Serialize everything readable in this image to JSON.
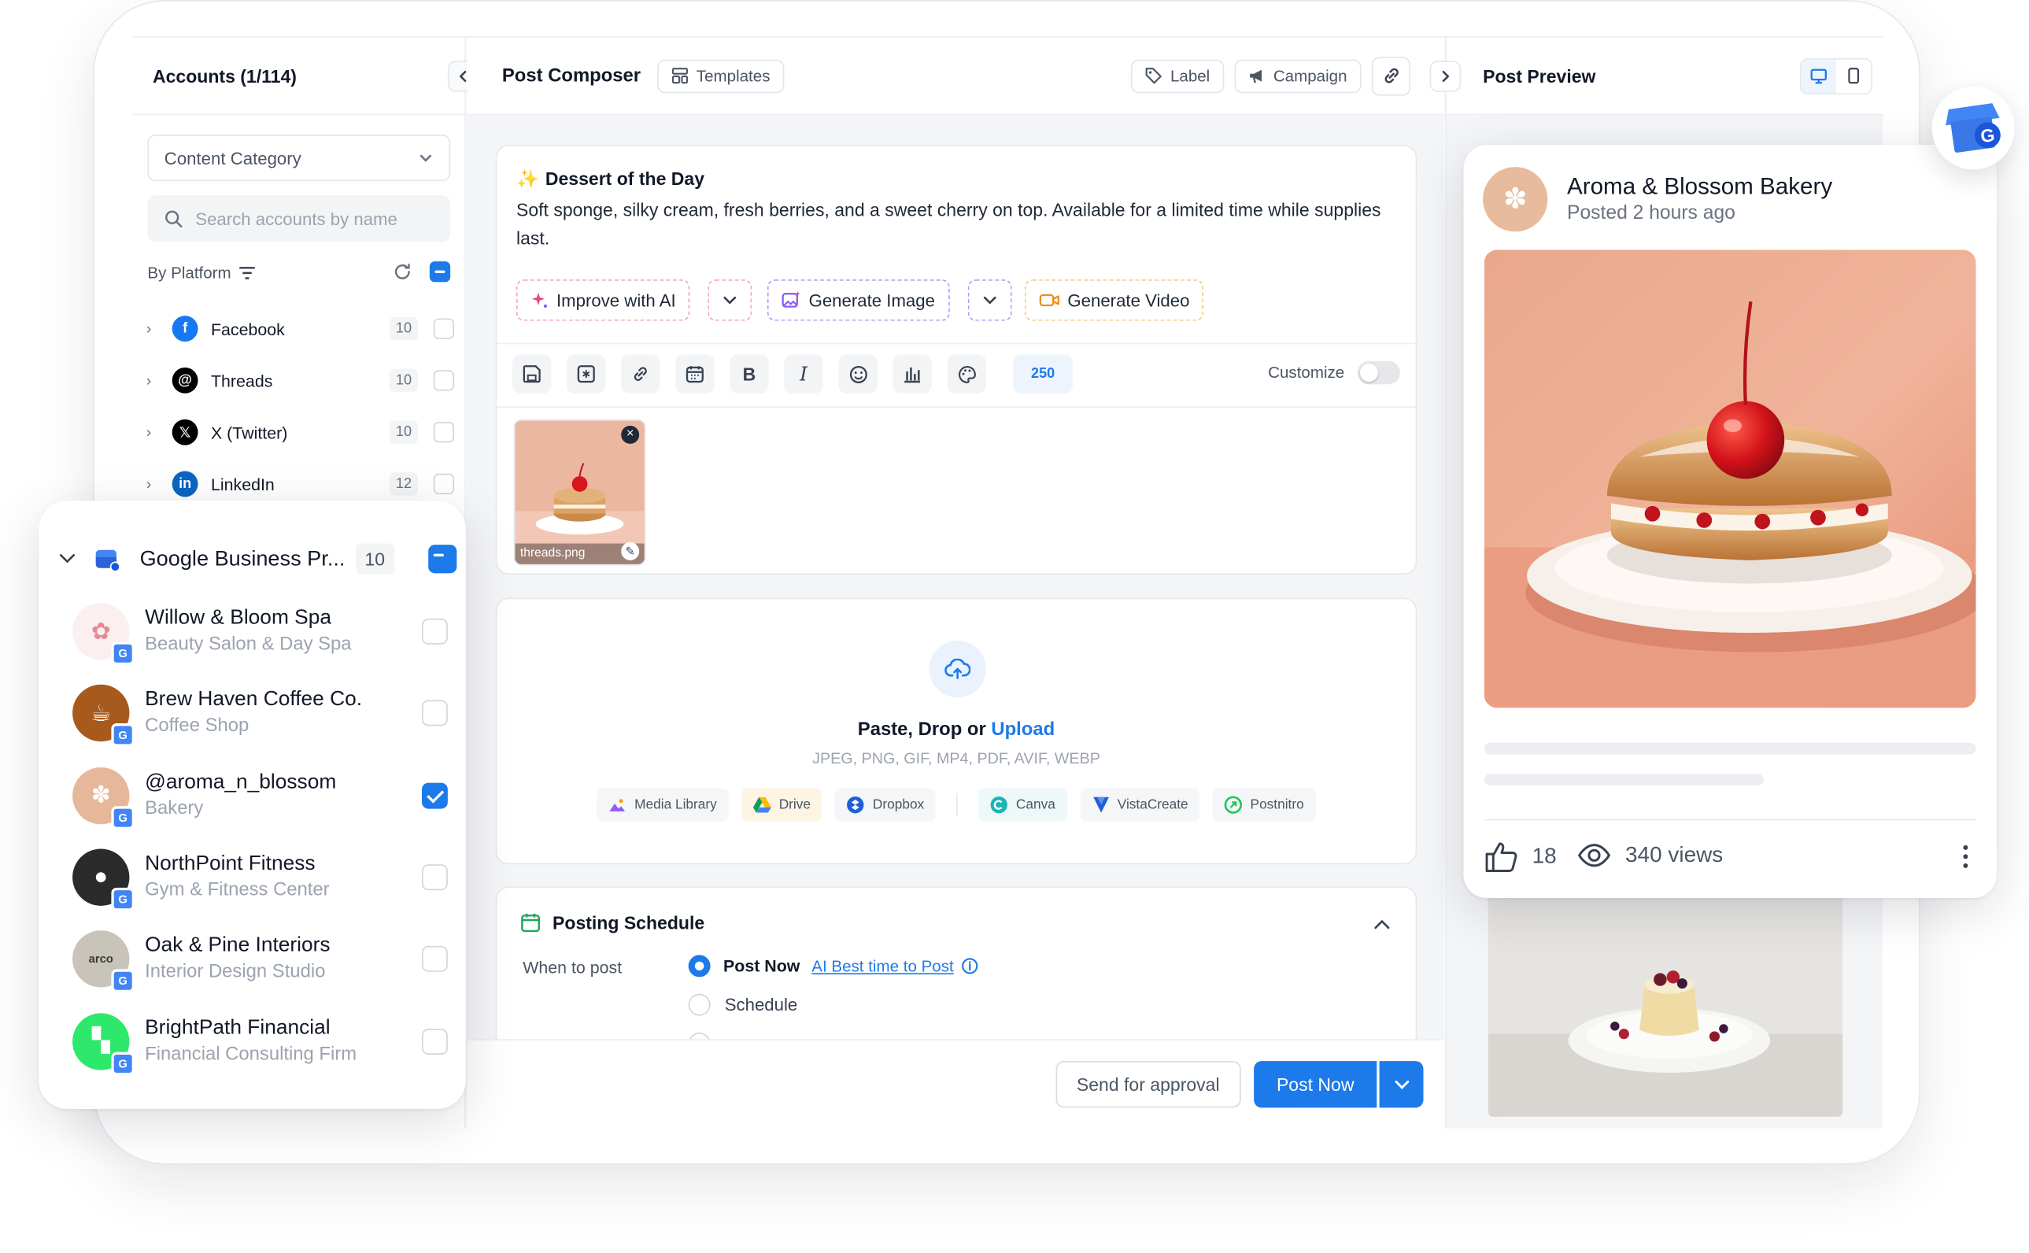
{
  "accounts_panel": {
    "title": "Accounts (1/114)",
    "category_select": "Content Category",
    "search_placeholder": "Search accounts by name",
    "filter_label": "By Platform",
    "platforms": [
      {
        "name": "Facebook",
        "count": "10",
        "color": "#1877f2",
        "glyph": "f"
      },
      {
        "name": "Threads",
        "count": "10",
        "color": "#000000",
        "glyph": "@"
      },
      {
        "name": "X (Twitter)",
        "count": "10",
        "color": "#000000",
        "glyph": "𝕏"
      },
      {
        "name": "LinkedIn",
        "count": "12",
        "color": "#0a66c2",
        "glyph": "in"
      }
    ]
  },
  "gbp_group": {
    "name": "Google Business Pr...",
    "count": "10",
    "accounts": [
      {
        "name": "Willow & Bloom Spa",
        "subtitle": "Beauty Salon & Day Spa",
        "checked": false,
        "avatar_bg": "#fbeff0",
        "avatar_glyph": "✿"
      },
      {
        "name": "Brew Haven Coffee Co.",
        "subtitle": "Coffee Shop",
        "checked": false,
        "avatar_bg": "#a85a1c",
        "avatar_glyph": "☕"
      },
      {
        "name": "@aroma_n_blossom",
        "subtitle": "Bakery",
        "checked": true,
        "avatar_bg": "#e6b899",
        "avatar_glyph": "✽"
      },
      {
        "name": "NorthPoint Fitness",
        "subtitle": "Gym & Fitness Center",
        "checked": false,
        "avatar_bg": "#2b2b2b",
        "avatar_glyph": "●"
      },
      {
        "name": "Oak & Pine Interiors",
        "subtitle": "Interior Design Studio",
        "checked": false,
        "avatar_bg": "#c9c4ba",
        "avatar_glyph": "arco"
      },
      {
        "name": "BrightPath Financial",
        "subtitle": "Financial Consulting Firm",
        "checked": false,
        "avatar_bg": "#2ee86b",
        "avatar_glyph": "▚"
      }
    ]
  },
  "composer": {
    "title": "Post Composer",
    "templates_label": "Templates",
    "label_btn": "Label",
    "campaign_btn": "Campaign",
    "post_title": "Dessert of the Day",
    "post_emoji": "✨",
    "post_body": "Soft sponge, silky cream, fresh berries, and a sweet cherry on top. Available for a limited time while supplies last.",
    "improve_ai": "Improve with AI",
    "generate_image": "Generate Image",
    "generate_video": "Generate Video",
    "char_count": "250",
    "customize_label": "Customize",
    "attachment_name": "threads.png",
    "upload": {
      "title_prefix": "Paste, Drop or ",
      "title_link": "Upload",
      "formats": "JPEG, PNG, GIF, MP4, PDF, AVIF, WEBP",
      "sources": [
        "Media Library",
        "Drive",
        "Dropbox"
      ],
      "integrations": [
        "Canva",
        "VistaCreate",
        "Postnitro"
      ]
    },
    "schedule": {
      "title": "Posting Schedule",
      "when_label": "When to post",
      "post_now": "Post Now",
      "ai_best_time": "AI Best time to Post",
      "schedule_option": "Schedule"
    },
    "send_approval": "Send for approval",
    "post_now_btn": "Post Now"
  },
  "preview": {
    "title": "Post Preview",
    "business_name": "Aroma & Blossom Bakery",
    "posted_time": "Posted 2 hours ago",
    "likes": "18",
    "views": "340 views"
  },
  "colors": {
    "accent": "#1d7aea",
    "ai_border": "#f3a6bd",
    "image_border": "#b39af7",
    "video_border": "#f5cc7f"
  }
}
